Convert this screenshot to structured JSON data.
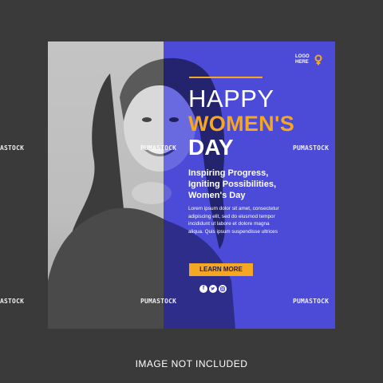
{
  "card": {
    "logo_line1": "LOGO",
    "logo_line2": "HERE",
    "headline_happy": "HAPPY",
    "headline_womens": "WOMEN'S",
    "headline_day": "DAY",
    "tagline": [
      "Inspiring Progress,",
      "Igniting Possibilities,",
      "Women's Day"
    ],
    "body": [
      "Lorem ipsum dolor sit amet, consectetur",
      "adipiscing elit, sed do eiusmod tempor",
      "incididunt ut labore et dolore magna",
      "aliqua. Quis ipsum suspendisse ultrices"
    ],
    "button_label": "LEARN MORE",
    "socials": [
      "facebook-icon",
      "twitter-icon",
      "instagram-icon"
    ],
    "colors": {
      "accent": "#f5a623",
      "panel": "#4b4bd8",
      "background": "#3a3a3a"
    }
  },
  "watermarks": {
    "text_full": "PUMASTOCK",
    "text_cut": "ASTOCK"
  },
  "footer": {
    "caption": "IMAGE NOT INCLUDED"
  }
}
